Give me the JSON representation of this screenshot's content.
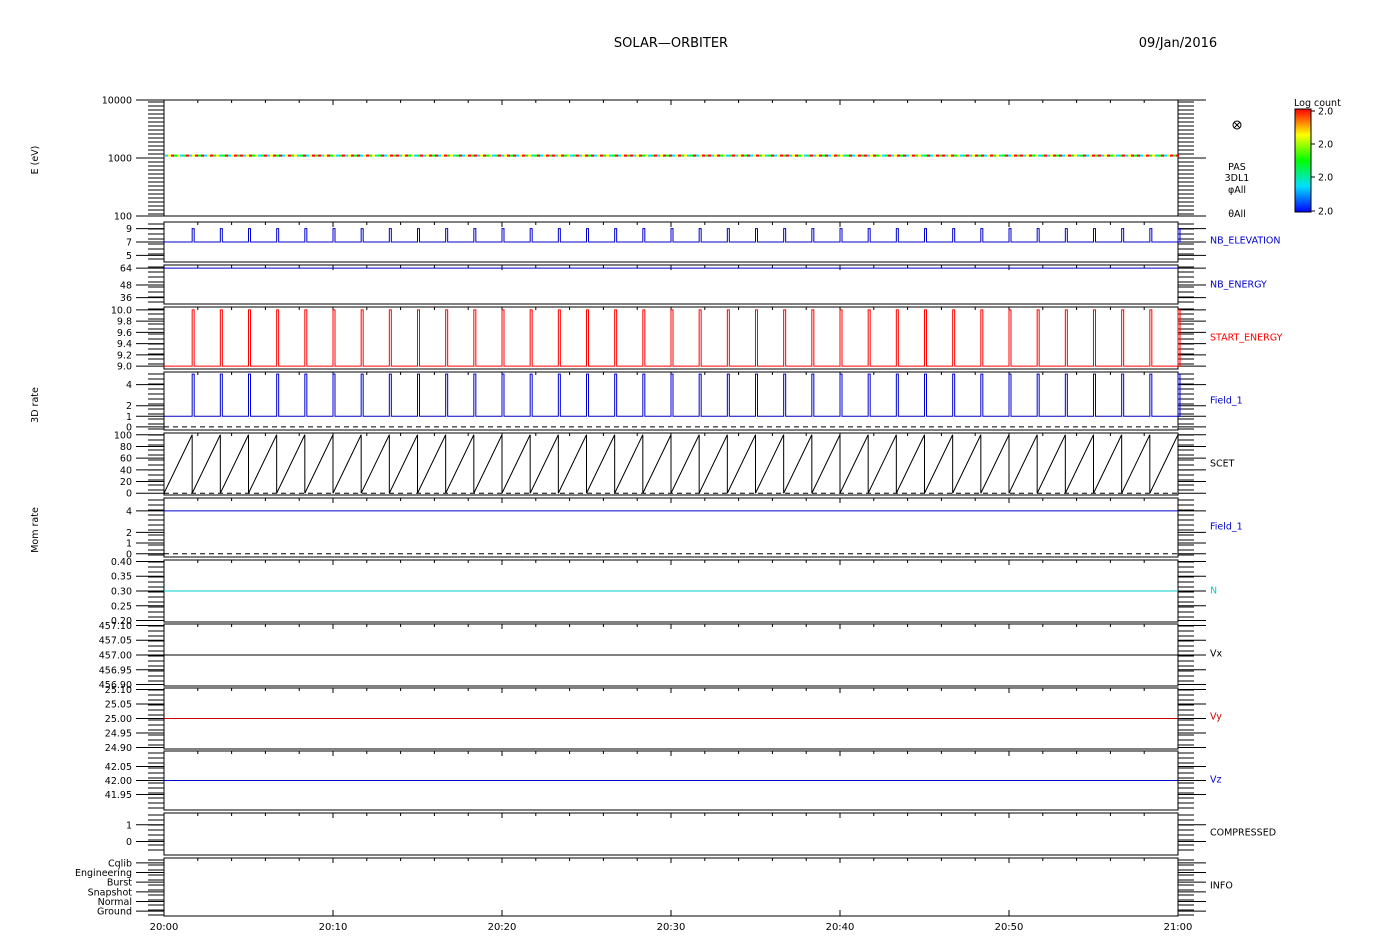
{
  "header": {
    "title": "SOLAR—ORBITER",
    "date": "09/Jan/2016"
  },
  "colorbar": {
    "title": "Log count",
    "ticks": [
      "2.0",
      "2.0",
      "2.0",
      "2.0"
    ],
    "colors": [
      "#ff0000",
      "#ffff00",
      "#00ff00",
      "#00e0ff",
      "#0000ff"
    ]
  },
  "spectrogram_labels": [
    "PAS",
    "3DL1",
    "φAll",
    "θAll"
  ],
  "group_labels": [
    {
      "text": "E (eV)",
      "panel": 0
    },
    {
      "text": "3D rate",
      "panel": 4
    },
    {
      "text": "Mom rate",
      "panel": 6
    }
  ],
  "time_axis": {
    "start": "20:00",
    "end": "21:00",
    "ticks": [
      "20:00",
      "20:10",
      "20:20",
      "20:30",
      "20:40",
      "20:50",
      "21:00"
    ]
  },
  "chart_data": [
    {
      "type": "heatmap",
      "panel": 0,
      "log": true,
      "ylim": [
        100,
        10000
      ],
      "ticks": [
        {
          "v": 100,
          "label": "100"
        },
        {
          "v": 1000,
          "label": "1000"
        },
        {
          "v": 10000,
          "label": "10000"
        }
      ],
      "band_energy": 1100
    },
    {
      "type": "line",
      "panel": 1,
      "name": "NB_ELEVATION",
      "color": "#0000cc",
      "ylim": [
        4,
        10
      ],
      "ticks": [
        {
          "v": 9,
          "label": "9"
        },
        {
          "v": 7,
          "label": "7"
        },
        {
          "v": 5,
          "label": "5"
        }
      ],
      "pattern": "spikes",
      "base": 7,
      "peak": 9
    },
    {
      "type": "line",
      "panel": 2,
      "name": "NB_ENERGY",
      "color": "#0000cc",
      "ylim": [
        30,
        67
      ],
      "ticks": [
        {
          "v": 64,
          "label": "64"
        },
        {
          "v": 48,
          "label": "48"
        },
        {
          "v": 36,
          "label": "36"
        }
      ],
      "pattern": "constant",
      "value": 64
    },
    {
      "type": "line",
      "panel": 3,
      "name": "START_ENERGY",
      "color": "#ff0000",
      "ylim": [
        8.95,
        10.05
      ],
      "ticks": [
        {
          "v": 10.0,
          "label": "10.0"
        },
        {
          "v": 9.8,
          "label": "9.8"
        },
        {
          "v": 9.6,
          "label": "9.6"
        },
        {
          "v": 9.4,
          "label": "9.4"
        },
        {
          "v": 9.2,
          "label": "9.2"
        },
        {
          "v": 9.0,
          "label": "9.0"
        }
      ],
      "pattern": "spikes",
      "base": 9.0,
      "peak": 10.0
    },
    {
      "type": "line",
      "panel": 4,
      "name": "Field_1",
      "color": "#0000cc",
      "ylim": [
        -0.3,
        5.2
      ],
      "ticks": [
        {
          "v": 4,
          "label": "4"
        },
        {
          "v": 2,
          "label": "2"
        },
        {
          "v": 1,
          "label": "1"
        },
        {
          "v": 0,
          "label": "0"
        }
      ],
      "pattern": "spikes",
      "base": 1,
      "peak": 5,
      "dashed_zero": true
    },
    {
      "type": "line",
      "panel": 5,
      "name": "SCET",
      "color": "#000000",
      "ylim": [
        -3,
        103
      ],
      "ticks": [
        {
          "v": 100,
          "label": "100"
        },
        {
          "v": 80,
          "label": "80"
        },
        {
          "v": 60,
          "label": "60"
        },
        {
          "v": 40,
          "label": "40"
        },
        {
          "v": 20,
          "label": "20"
        },
        {
          "v": 0,
          "label": "0"
        }
      ],
      "pattern": "sawtooth",
      "base": 0,
      "peak": 100,
      "dashed_zero": true
    },
    {
      "type": "line",
      "panel": 6,
      "name": "Field_1",
      "color": "#0000cc",
      "ylim": [
        -0.3,
        5.2
      ],
      "ticks": [
        {
          "v": 4,
          "label": "4"
        },
        {
          "v": 2,
          "label": "2"
        },
        {
          "v": 1,
          "label": "1"
        },
        {
          "v": 0,
          "label": "0"
        }
      ],
      "pattern": "constant",
      "value": 4,
      "dashed_zero": true
    },
    {
      "type": "line",
      "panel": 7,
      "name": "N",
      "color": "#00cccc",
      "ylim": [
        0.195,
        0.405
      ],
      "ticks": [
        {
          "v": 0.4,
          "label": "0.40"
        },
        {
          "v": 0.35,
          "label": "0.35"
        },
        {
          "v": 0.3,
          "label": "0.30"
        },
        {
          "v": 0.25,
          "label": "0.25"
        },
        {
          "v": 0.2,
          "label": "0.20"
        }
      ],
      "pattern": "constant",
      "value": 0.3
    },
    {
      "type": "line",
      "panel": 8,
      "name": "Vx",
      "color": "#000000",
      "ylim": [
        456.895,
        457.105
      ],
      "ticks": [
        {
          "v": 457.1,
          "label": "457.10"
        },
        {
          "v": 457.05,
          "label": "457.05"
        },
        {
          "v": 457.0,
          "label": "457.00"
        },
        {
          "v": 456.95,
          "label": "456.95"
        },
        {
          "v": 456.9,
          "label": "456.90"
        }
      ],
      "pattern": "constant",
      "value": 457.0
    },
    {
      "type": "line",
      "panel": 9,
      "name": "Vy",
      "color": "#cc0000",
      "ylim": [
        24.895,
        25.105
      ],
      "ticks": [
        {
          "v": 25.1,
          "label": "25.10"
        },
        {
          "v": 25.05,
          "label": "25.05"
        },
        {
          "v": 25.0,
          "label": "25.00"
        },
        {
          "v": 24.95,
          "label": "24.95"
        },
        {
          "v": 24.9,
          "label": "24.90"
        }
      ],
      "pattern": "constant",
      "value": 25.0
    },
    {
      "type": "line",
      "panel": 10,
      "name": "Vz",
      "color": "#0000cc",
      "ylim": [
        41.895,
        42.105
      ],
      "ticks": [
        {
          "v": 42.05,
          "label": "42.05"
        },
        {
          "v": 42.0,
          "label": "42.00"
        },
        {
          "v": 41.95,
          "label": "41.95"
        }
      ],
      "pattern": "constant",
      "value": 42.0
    },
    {
      "type": "line",
      "panel": 11,
      "name": "COMPRESSED",
      "color": "#000000",
      "ylim": [
        -0.8,
        1.7
      ],
      "ticks": [
        {
          "v": 1,
          "label": "1"
        },
        {
          "v": 0,
          "label": "0"
        }
      ],
      "pattern": "none"
    },
    {
      "type": "line",
      "panel": 12,
      "name": "INFO",
      "color": "#000000",
      "ylim": [
        -0.5,
        5.5
      ],
      "ticks": [
        {
          "v": 5,
          "label": "Cqlib"
        },
        {
          "v": 4,
          "label": "Engineering"
        },
        {
          "v": 3,
          "label": "Burst"
        },
        {
          "v": 2,
          "label": "Snapshot"
        },
        {
          "v": 1,
          "label": "Normal"
        },
        {
          "v": 0,
          "label": "Ground"
        }
      ],
      "pattern": "none"
    }
  ]
}
